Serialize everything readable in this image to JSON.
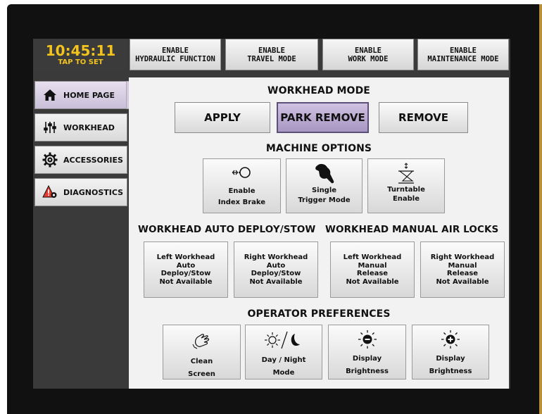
{
  "clock": {
    "time": "10:45:11",
    "tap_label": "TAP TO SET"
  },
  "top_buttons": [
    {
      "line1": "ENABLE",
      "line2": "HYDRAULIC FUNCTION"
    },
    {
      "line1": "ENABLE",
      "line2": "TRAVEL MODE"
    },
    {
      "line1": "ENABLE",
      "line2": "WORK MODE"
    },
    {
      "line1": "ENABLE",
      "line2": "MAINTENANCE MODE"
    }
  ],
  "sidebar": {
    "items": [
      {
        "label": "HOME PAGE",
        "icon": "home-icon",
        "active": true
      },
      {
        "label": "WORKHEAD",
        "icon": "sliders-icon",
        "active": false
      },
      {
        "label": "ACCESSORIES",
        "icon": "gear-icon",
        "active": false
      },
      {
        "label": "DIAGNOSTICS",
        "icon": "warning-icon",
        "active": false
      }
    ]
  },
  "workhead_mode": {
    "title": "WORKHEAD MODE",
    "apply": "APPLY",
    "park_remove": "PARK REMOVE",
    "remove": "REMOVE",
    "selected": "PARK REMOVE"
  },
  "machine_options": {
    "title": "MACHINE OPTIONS",
    "tiles": [
      {
        "line1": "Enable",
        "line2": "Index Brake",
        "icon": "index-brake-icon"
      },
      {
        "line1": "Single",
        "line2": "Trigger Mode",
        "icon": "hand-trigger-icon"
      },
      {
        "line1": "Turntable",
        "line2": "Enable",
        "icon": "turntable-icon"
      }
    ]
  },
  "auto_deploy": {
    "title": "WORKHEAD AUTO DEPLOY/STOW",
    "tiles": [
      {
        "lines": [
          "Left Workhead",
          "Auto",
          "Deploy/Stow",
          "Not Available"
        ]
      },
      {
        "lines": [
          "Right Workhead",
          "Auto",
          "Deploy/Stow",
          "Not Available"
        ]
      }
    ]
  },
  "air_locks": {
    "title": "WORKHEAD MANUAL AIR LOCKS",
    "tiles": [
      {
        "lines": [
          "Left Workhead",
          "Manual",
          "Release",
          "Not Available"
        ]
      },
      {
        "lines": [
          "Right Workhead",
          "Manual",
          "Release",
          "Not Available"
        ]
      }
    ]
  },
  "operator_preferences": {
    "title": "OPERATOR PREFERENCES",
    "tiles": [
      {
        "line1": "Clean",
        "line2": "Screen",
        "icon": "clean-hand-icon"
      },
      {
        "line1": "Day / Night",
        "line2": "Mode",
        "icon": "sun-moon-icon"
      },
      {
        "line1": "Display",
        "line2": "Brightness",
        "icon": "brightness-down-icon"
      },
      {
        "line1": "Display",
        "line2": "Brightness",
        "icon": "brightness-up-icon"
      }
    ]
  },
  "colors": {
    "clock_text": "#f2c21d",
    "selected_button": "#b7a8d0",
    "screen_bg": "#3a3a3a"
  }
}
